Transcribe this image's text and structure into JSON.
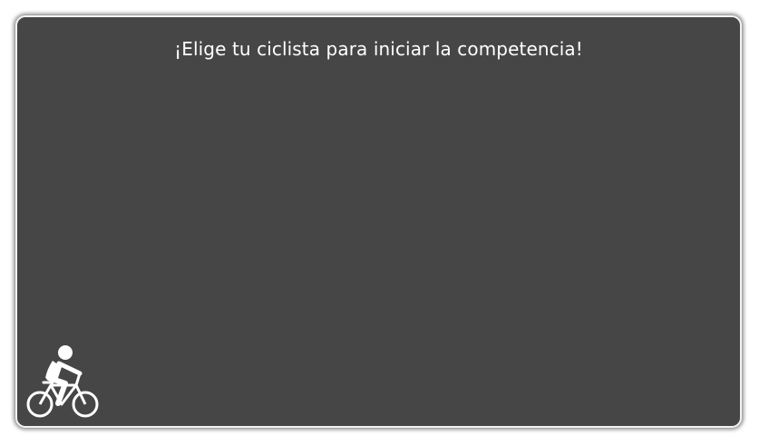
{
  "game": {
    "prompt": "¡Elige tu ciclista para iniciar la competencia!"
  },
  "icons": {
    "player": "cyclist-icon"
  },
  "colors": {
    "panel_background": "#464646",
    "panel_border": "#f2f2f2",
    "text": "#ffffff"
  }
}
